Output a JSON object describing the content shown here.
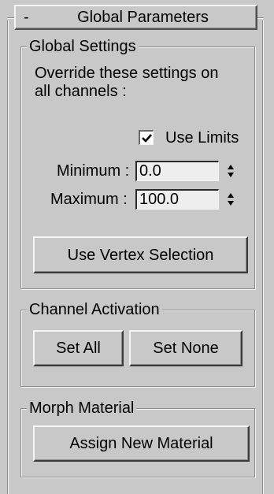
{
  "rollout": {
    "collapse_symbol": "-",
    "title": "Global Parameters"
  },
  "global_settings": {
    "label": "Global Settings",
    "description_line1": "Override these settings on",
    "description_line2": "all channels :",
    "use_limits_label": "Use Limits",
    "use_limits_checked": true,
    "minimum_label": "Minimum :",
    "minimum_value": "0.0",
    "maximum_label": "Maximum :",
    "maximum_value": "100.0",
    "use_vertex_selection_label": "Use Vertex Selection"
  },
  "channel_activation": {
    "label": "Channel Activation",
    "set_all_label": "Set All",
    "set_none_label": "Set None"
  },
  "morph_material": {
    "label": "Morph Material",
    "assign_label": "Assign New Material"
  },
  "icons": {
    "checkmark": "checkmark-icon",
    "spinner": "spinner-arrows-icon"
  }
}
